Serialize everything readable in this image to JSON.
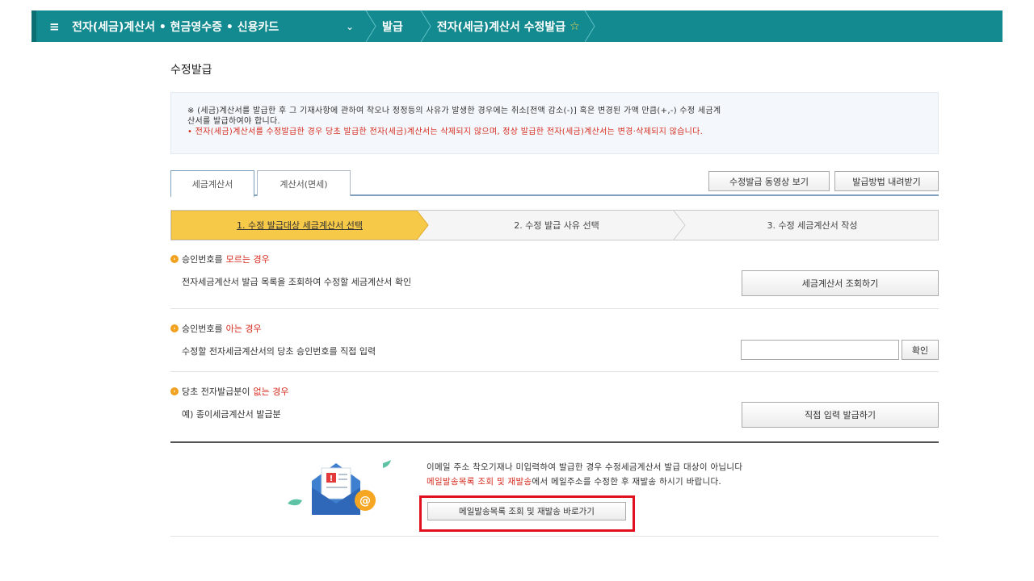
{
  "topbar": {
    "menu_glyph": "≡",
    "main": "전자(세금)계산서 • 현금영수증 • 신용카드",
    "dropdown_glyph": "⌄",
    "issue": "발급",
    "current": "전자(세금)계산서 수정발급",
    "star_glyph": "☆"
  },
  "page": {
    "title": "수정발급"
  },
  "notice": {
    "line1": "※ (세금)계산서를 발급한 후 그 기재사항에 관하여 착오나 정정등의 사유가 발생한 경우에는 취소[전액 감소(-)] 혹은 변경된 가액 만큼(+,-) 수정 세금계",
    "line2": "산서를 발급하여야 합니다.",
    "line3": "• 전자(세금)계산서를 수정발급한 경우 당초 발급한 전자(세금)계산서는 삭제되지 않으며, 정상 발급한 전자(세금)계산서는 변경·삭제되지 않습니다."
  },
  "tabs": [
    {
      "label": "세금계산서"
    },
    {
      "label": "계산서(면세)"
    }
  ],
  "top_buttons": {
    "video": "수정발급 동영상 보기",
    "download": "발급방법 내려받기"
  },
  "steps": [
    {
      "label": "1. 수정 발급대상 세금계산서 선택"
    },
    {
      "label": "2. 수정 발급 사유 선택"
    },
    {
      "label": "3. 수정 세금계산서 작성"
    }
  ],
  "sections": {
    "unknown": {
      "title_prefix": "승인번호를 ",
      "title_highlight": "모르는 경우",
      "desc": "전자세금계산서 발급 목록을 조회하여 수정할 세금계산서 확인",
      "button": "세금계산서 조회하기"
    },
    "known": {
      "title_prefix": "승인번호를 ",
      "title_highlight": "아는 경우",
      "desc": "수정할 전자세금계산서의 당초 승인번호를 직접 입력",
      "input_value": "",
      "button": "확인"
    },
    "none": {
      "title_prefix": "당초 전자발급분이 ",
      "title_highlight": "없는 경우",
      "desc": "예) 종이세금계산서 발급분",
      "button": "직접 입력 발급하기"
    }
  },
  "email": {
    "line1": "이메일 주소 착오기재나 미입력하여 발급한 경우 수정세금계산서 발급 대상이 아닙니다",
    "line2_red": "메일발송목록 조회 및 재발송",
    "line2_rest": "에서 메일주소를 수정한 후 재발송 하시기 바랍니다.",
    "button": "메일발송목록 조회 및 재발송 바로가기"
  },
  "colors": {
    "topbar": "#128a8f",
    "step_active": "#f7c948",
    "highlight_red": "#d62b1f",
    "callout_box": "#e0101e"
  }
}
